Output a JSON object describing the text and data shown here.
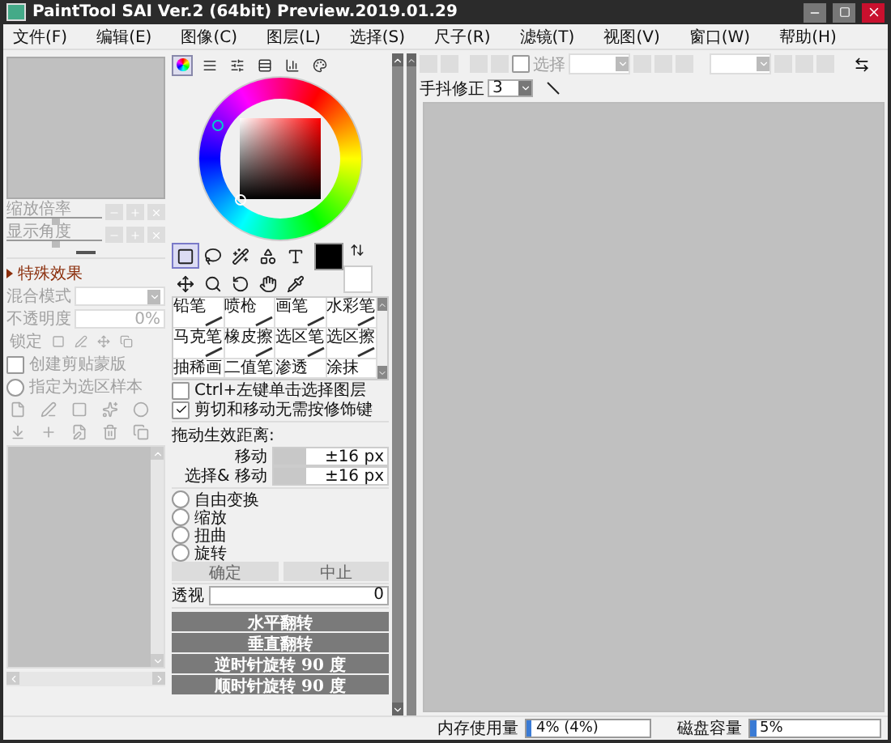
{
  "window": {
    "title": "PaintTool SAI Ver.2 (64bit) Preview.2019.01.29"
  },
  "menu": [
    "文件(F)",
    "编辑(E)",
    "图像(C)",
    "图层(L)",
    "选择(S)",
    "尺子(R)",
    "滤镜(T)",
    "视图(V)",
    "窗口(W)",
    "帮助(H)"
  ],
  "navigator": {
    "sliders": [
      {
        "label": "缩放倍率",
        "level": 0.5
      },
      {
        "label": "显示角度",
        "level": 0.5
      }
    ]
  },
  "layer_props": {
    "section": "特殊效果",
    "blend_label": "混合模式",
    "opacity_label": "不透明度",
    "opacity_value": "0%",
    "lock_label": "锁定",
    "options": [
      {
        "label": "创建剪贴蒙版",
        "kind": "checkbox",
        "checked": false
      },
      {
        "label": "指定为选区样本",
        "kind": "radio",
        "checked": false
      }
    ]
  },
  "color_tabs": [
    {
      "selected": true
    },
    {
      "selected": false
    },
    {
      "selected": false
    },
    {
      "selected": false
    },
    {
      "selected": false
    },
    {
      "selected": false
    }
  ],
  "tools": [
    {
      "kind": "select",
      "selected": true
    },
    {
      "kind": "lasso",
      "selected": false
    },
    {
      "kind": "wand",
      "selected": false
    },
    {
      "kind": "shapes",
      "selected": false
    },
    {
      "kind": "text",
      "selected": false
    },
    {
      "kind": "move",
      "selected": false
    },
    {
      "kind": "zoom",
      "selected": false
    },
    {
      "kind": "rotate",
      "selected": false
    },
    {
      "kind": "hand",
      "selected": false
    },
    {
      "kind": "pipette",
      "selected": false
    }
  ],
  "brushes": [
    {
      "label": "铅笔"
    },
    {
      "label": "喷枪"
    },
    {
      "label": "画笔"
    },
    {
      "label": "水彩笔"
    },
    {
      "label": "马克笔"
    },
    {
      "label": "橡皮擦"
    },
    {
      "label": "选区笔"
    },
    {
      "label": "选区擦"
    },
    {
      "label": "抽稀画"
    },
    {
      "label": "二值笔"
    },
    {
      "label": "渗透"
    },
    {
      "label": "涂抹"
    }
  ],
  "options": [
    {
      "label": "Ctrl+左键单击选择图层",
      "checked": false
    },
    {
      "label": "剪切和移动无需按修饰键",
      "checked": true
    }
  ],
  "drag_distance": {
    "label": "拖动生效距离:",
    "rows": [
      {
        "label": "移动",
        "value": "±16 px"
      },
      {
        "label": "选择& 移动",
        "value": "±16 px"
      }
    ]
  },
  "transforms": [
    {
      "label": "自由变换",
      "selected": false
    },
    {
      "label": "缩放",
      "selected": false
    },
    {
      "label": "扭曲",
      "selected": false
    },
    {
      "label": "旋转",
      "selected": false
    }
  ],
  "confirm_buttons": [
    {
      "label": "确定",
      "disabled": true
    },
    {
      "label": "中止",
      "disabled": true
    }
  ],
  "perspective": {
    "label": "透视",
    "value": "0"
  },
  "flip_buttons": [
    "水平翻转",
    "垂直翻转",
    "逆时针旋转 90 度",
    "顺时针旋转 90 度"
  ],
  "canvas_toolbar": {
    "select_label": "选择",
    "select_checked": false,
    "stabilizer_label": "手抖修正",
    "stabilizer_value": "3"
  },
  "status_bar": {
    "memory": {
      "label": "内存使用量",
      "value": "4% (4%)",
      "level": 0.04
    },
    "disk": {
      "label": "磁盘容量",
      "value": "5%",
      "level": 0.05
    }
  }
}
